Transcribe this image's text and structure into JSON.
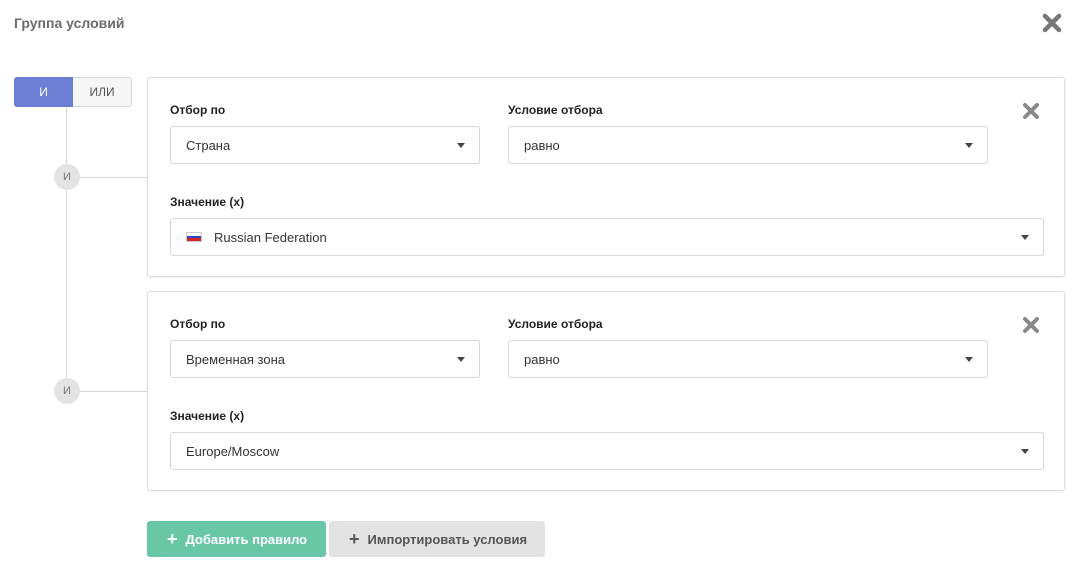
{
  "dialog": {
    "title": "Группа условий",
    "close_icon": "close-icon"
  },
  "logic": {
    "and_label": "И",
    "or_label": "ИЛИ",
    "active": "and",
    "accent_color": "#6a7ed4"
  },
  "tree": {
    "node_label": "И"
  },
  "rules": [
    {
      "filter_label": "Отбор по",
      "filter_value": "Страна",
      "condition_label": "Условие отбора",
      "condition_value": "равно",
      "value_label": "Значение (x)",
      "value": "Russian Federation",
      "value_icon": "russia-flag-icon"
    },
    {
      "filter_label": "Отбор по",
      "filter_value": "Временная зона",
      "condition_label": "Условие отбора",
      "condition_value": "равно",
      "value_label": "Значение (x)",
      "value": "Europe/Moscow"
    }
  ],
  "actions": {
    "add_rule_label": "Добавить правило",
    "import_label": "Импортировать условия",
    "add_color": "#6ac7a6",
    "import_color": "#e3e3e3"
  }
}
